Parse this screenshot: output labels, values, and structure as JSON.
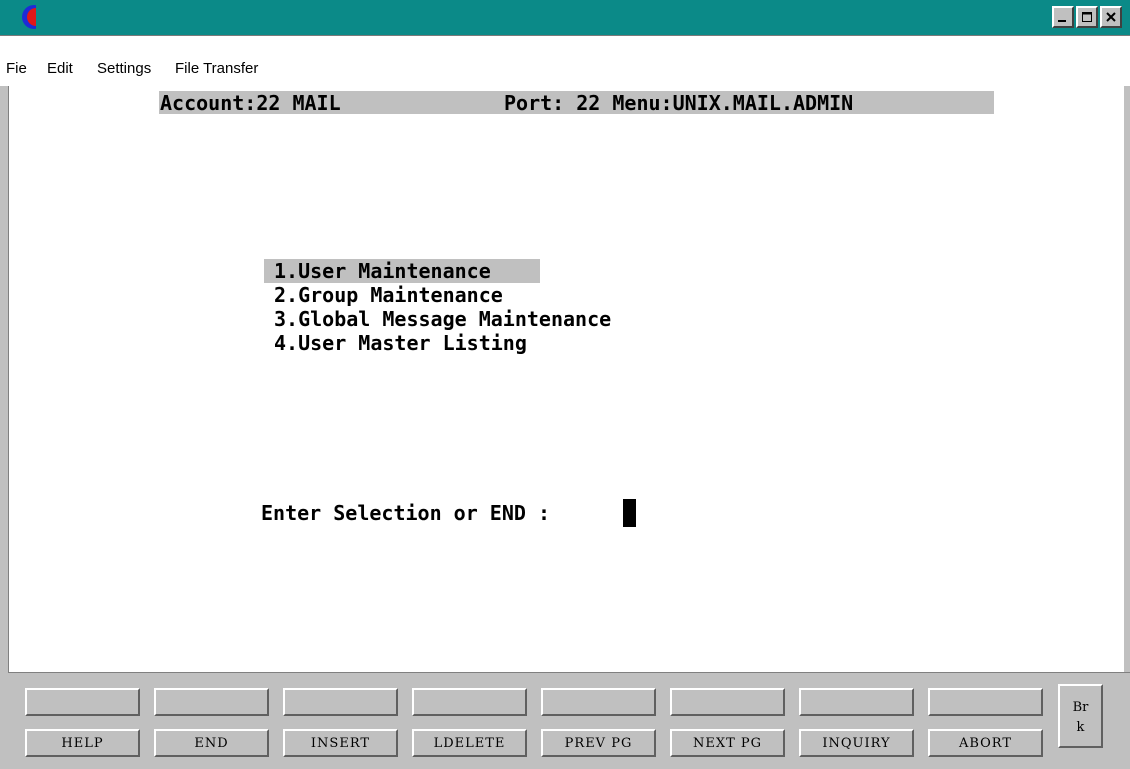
{
  "menubar": {
    "items": [
      "Fie",
      "Edit",
      "Settings",
      "File Transfer"
    ]
  },
  "status": {
    "account": "Account:22 MAIL",
    "port": "Port: 22 Menu:UNIX.MAIL.ADMIN"
  },
  "menu": {
    "options": [
      "1.User Maintenance",
      "2.Group Maintenance",
      "3.Global Message Maintenance",
      "4.User Master Listing"
    ],
    "selected_index": 0,
    "prompt": "Enter Selection or END :"
  },
  "fkeys": {
    "labels": [
      "HELP",
      "END",
      "INSERT",
      "LDELETE",
      "PREV PG",
      "NEXT PG",
      "INQUIRY",
      "ABORT"
    ],
    "brk_line1": "Br",
    "brk_line2": "k"
  },
  "colors": {
    "titlebar": "#0b8a88",
    "panel": "#c0c0c0",
    "terminal_bg": "#ffffff"
  },
  "icons": {
    "app": "terminal-app-icon",
    "minimize": "minimize-icon",
    "maximize": "maximize-icon",
    "close": "close-icon"
  }
}
